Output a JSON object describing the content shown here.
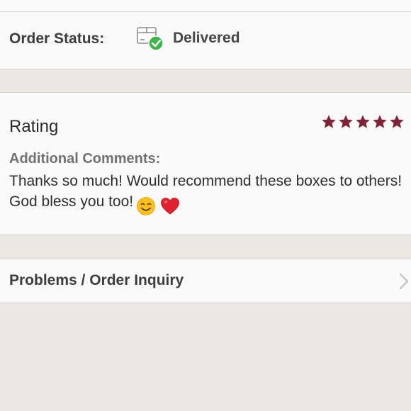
{
  "order_status": {
    "label": "Order Status:",
    "value": "Delivered",
    "icon": "delivered-box-icon"
  },
  "rating": {
    "title": "Rating",
    "stars": 5,
    "max_stars": 5,
    "star_color": "#7f2233"
  },
  "comments": {
    "label": "Additional Comments:",
    "text": "Thanks so much! Would recommend these boxes to others! God bless you too!",
    "emojis": [
      "smiling-face-emoji",
      "red-heart-emoji"
    ]
  },
  "problems": {
    "label": "Problems / Order Inquiry",
    "icon": "chevron-right-icon"
  },
  "colors": {
    "background": "#ebe8e3",
    "card": "#fbfafb",
    "check_green": "#3cb54a"
  }
}
